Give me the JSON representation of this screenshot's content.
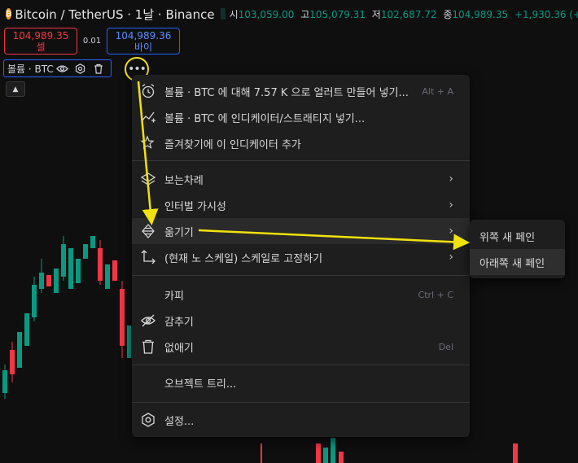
{
  "header": {
    "symbol_title": "Bitcoin / TetherUS · 1날 · Binance",
    "ohlc": [
      {
        "key": "시",
        "value": "103,059.00"
      },
      {
        "key": "고",
        "value": "105,079.31"
      },
      {
        "key": "저",
        "value": "102,687.72"
      },
      {
        "key": "종",
        "value": "104,989.35"
      }
    ],
    "change": "+1,930.36 (+1",
    "colors": {
      "up": "#089981",
      "down": "#f23645"
    }
  },
  "trade": {
    "sell_price": "104,989.35",
    "sell_label": "셀",
    "spread": "0.01",
    "buy_price": "104,989.36",
    "buy_label": "바이"
  },
  "indicator": {
    "name": "볼륨 · BTC",
    "icons": [
      "eye-icon",
      "settings-icon",
      "trash-icon",
      "more-icon"
    ],
    "collapse_icon": "chevron-up-icon"
  },
  "menu": {
    "items": [
      {
        "icon": "alarm-plus-icon",
        "label": "볼륨 · BTC 에 대해 7.57 K 으로 얼러트 만들어 넣기...",
        "shortcut": "Alt + A"
      },
      {
        "icon": "indicator-add-icon",
        "label": "볼륨 · BTC 에 인디케이터/스트래티지 넣기..."
      },
      {
        "icon": "star-plus-icon",
        "label": "즐겨찾기에 이 인디케이터 추가"
      },
      {
        "icon": "layers-icon",
        "label": "보는차례",
        "submenu": true
      },
      {
        "label": "인터벌 가시성",
        "submenu": true
      },
      {
        "icon": "move-icon",
        "label": "옮기기",
        "submenu": true,
        "highlighted": true
      },
      {
        "icon": "pin-scale-icon",
        "label": "(현재 노 스케일) 스케일로 고정하기",
        "submenu": true
      },
      {
        "label": "카피",
        "shortcut": "Ctrl + C"
      },
      {
        "icon": "eye-off-icon",
        "label": "감추기"
      },
      {
        "icon": "trash-icon",
        "label": "없애기",
        "shortcut": "Del"
      },
      {
        "label": "오브젝트 트리..."
      },
      {
        "icon": "settings-icon",
        "label": "설정..."
      }
    ]
  },
  "submenu": {
    "items": [
      {
        "label": "위쪽 새 페인"
      },
      {
        "label": "아래쪽 새 페인",
        "highlighted": true
      }
    ]
  },
  "annotation": {
    "color": "#f1e20c"
  }
}
